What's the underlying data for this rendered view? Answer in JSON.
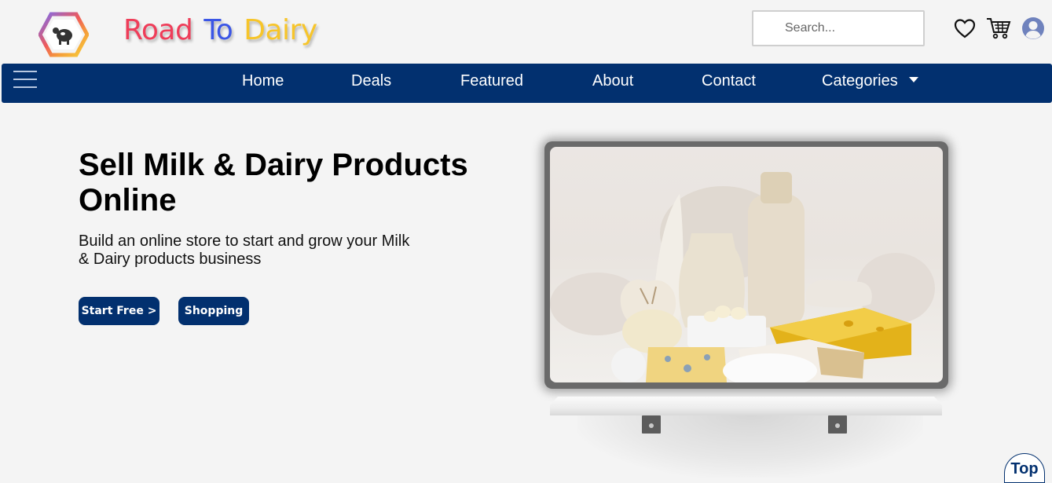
{
  "header": {
    "brand": {
      "word1": "Road",
      "word2": "To",
      "word3": "Dairy"
    },
    "search_placeholder": "Search...",
    "icons": [
      "heart-icon",
      "cart-icon",
      "user-icon"
    ]
  },
  "nav": {
    "items": [
      {
        "label": "Home"
      },
      {
        "label": "Deals"
      },
      {
        "label": "Featured"
      },
      {
        "label": "About"
      },
      {
        "label": "Contact"
      },
      {
        "label": "Categories"
      }
    ]
  },
  "hero": {
    "title": "Sell Milk & Dairy Products Online",
    "subtitle": "Build an online store to start and grow your Milk & Dairy products business",
    "start_button": "Start Free >",
    "shopping_button": "Shopping"
  },
  "top_button": "Top",
  "colors": {
    "navy": "#02306f",
    "brand_red": "#ef3d59",
    "brand_blue": "#3b56e6",
    "brand_yellow": "#f7c52a",
    "background": "#f4f4f4"
  }
}
